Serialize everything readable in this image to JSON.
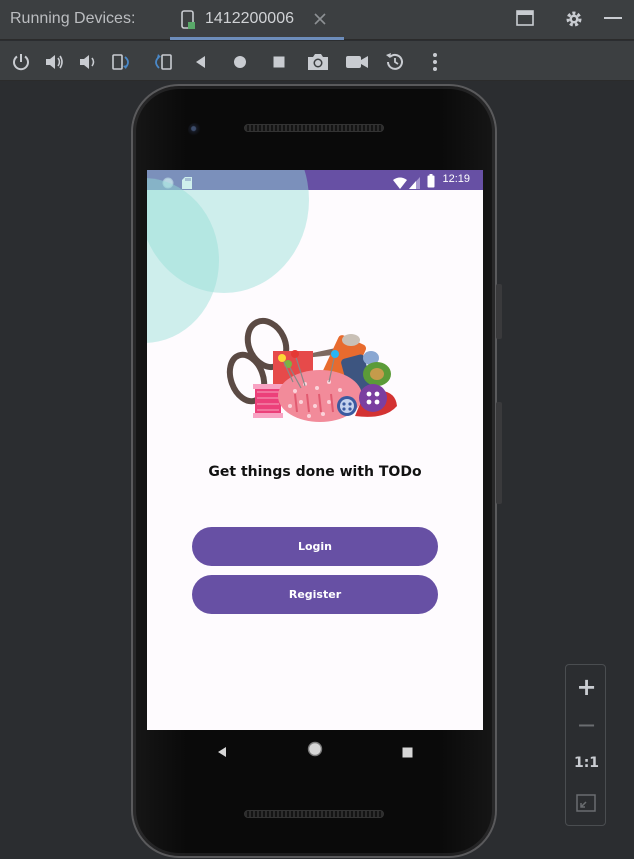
{
  "window": {
    "title": "Running Devices:",
    "tab_label": "1412200006"
  },
  "toolbar": {
    "items": [
      "power-icon",
      "volume-up-icon",
      "volume-down-icon",
      "rotate-left-icon",
      "rotate-right-icon",
      "back-icon",
      "home-icon",
      "overview-icon",
      "screenshot-icon",
      "screen-record-icon",
      "snapshot-icon",
      "more-icon"
    ]
  },
  "status_bar": {
    "time": "12:19"
  },
  "app": {
    "headline": "Get things done with TODo",
    "login_label": "Login",
    "register_label": "Register",
    "accent": "#6750a4",
    "circle_color": "#94ded6"
  },
  "zoom_panel": {
    "zoom_in": "+",
    "zoom_out": "−",
    "actual_size": "1:1"
  }
}
